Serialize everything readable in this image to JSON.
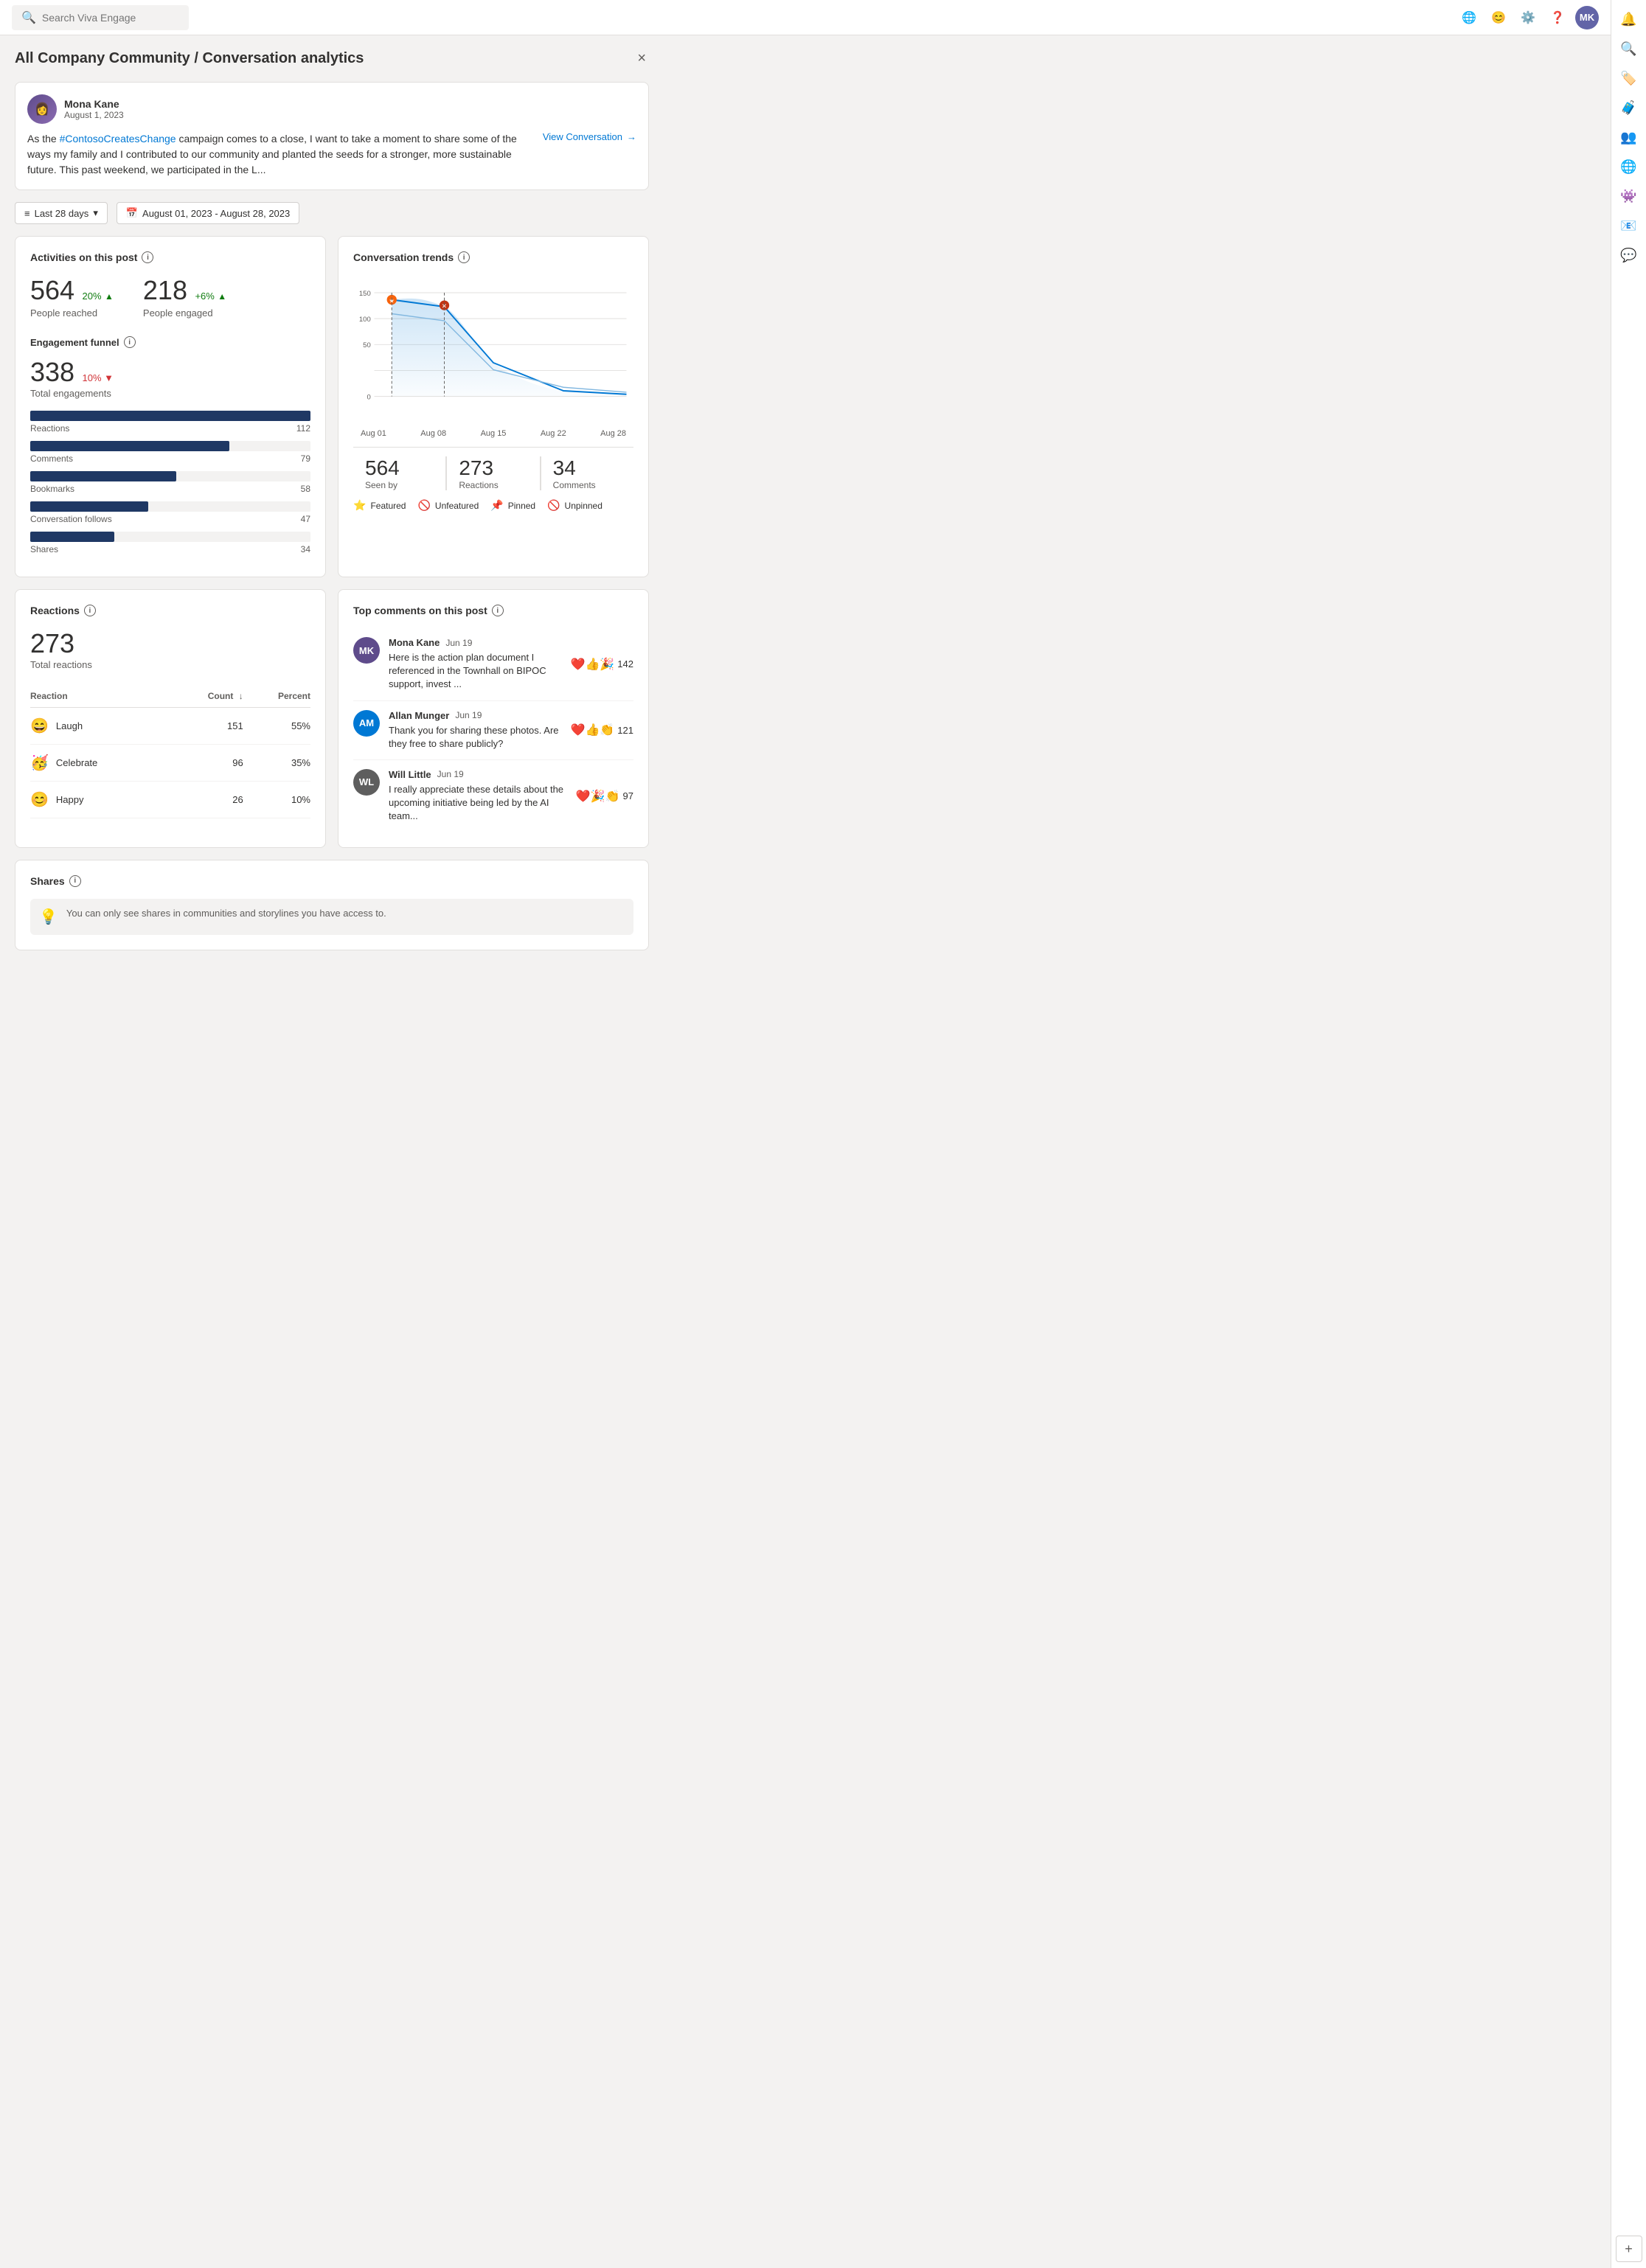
{
  "nav": {
    "search_placeholder": "Search Viva Engage",
    "icons": [
      "🌐",
      "😊",
      "⚙️",
      "❓"
    ]
  },
  "page": {
    "title": "All Company Community / Conversation analytics",
    "close_label": "×"
  },
  "post": {
    "author": "Mona Kane",
    "date": "August 1, 2023",
    "avatar_initials": "MK",
    "text_before_link": "As the ",
    "link_text": "#ContosoCreatesChange",
    "text_after": " campaign comes to a close, I want to take a moment to share some of the ways my family and I contributed to our community and planted the seeds for a stronger, more sustainable future. This past weekend, we participated in the L...",
    "view_conversation": "View Conversation"
  },
  "filter": {
    "period_label": "Last 28 days",
    "date_range": "August 01, 2023 - August 28, 2023"
  },
  "activities": {
    "title": "Activities on this post",
    "people_reached": {
      "number": "564",
      "change": "20%",
      "direction": "up",
      "label": "People reached"
    },
    "people_engaged": {
      "number": "218",
      "change": "+6%",
      "direction": "up",
      "label": "People engaged"
    },
    "engagement_funnel": {
      "title": "Engagement funnel",
      "total": "338",
      "change": "10%",
      "direction": "down",
      "label": "Total engagements",
      "bars": [
        {
          "label": "Reactions",
          "value": 112,
          "max": 112,
          "percent": 100
        },
        {
          "label": "Comments",
          "value": 79,
          "max": 112,
          "percent": 71
        },
        {
          "label": "Bookmarks",
          "value": 58,
          "max": 112,
          "percent": 52
        },
        {
          "label": "Conversation follows",
          "value": 47,
          "max": 112,
          "percent": 42
        },
        {
          "label": "Shares",
          "value": 34,
          "max": 112,
          "percent": 30
        }
      ]
    }
  },
  "trends": {
    "title": "Conversation trends",
    "stats": [
      {
        "number": "564",
        "label": "Seen by"
      },
      {
        "number": "273",
        "label": "Reactions"
      },
      {
        "number": "34",
        "label": "Comments"
      }
    ],
    "x_labels": [
      "Aug 01",
      "Aug 08",
      "Aug 15",
      "Aug 22",
      "Aug 28"
    ],
    "legend": [
      {
        "label": "Featured",
        "icon": "⭐",
        "color": "#0078d4"
      },
      {
        "label": "Unfeatured",
        "icon": "🚫",
        "color": "#5e5e5e"
      },
      {
        "label": "Pinned",
        "icon": "📌",
        "color": "#c13515"
      },
      {
        "label": "Unpinned",
        "icon": "🚫",
        "color": "#c13515"
      }
    ]
  },
  "reactions": {
    "title": "Reactions",
    "total": "273",
    "label": "Total reactions",
    "col_reaction": "Reaction",
    "col_count": "Count",
    "col_percent": "Percent",
    "items": [
      {
        "emoji": "😄",
        "name": "Laugh",
        "count": 151,
        "percent": "55%"
      },
      {
        "emoji": "🥳",
        "name": "Celebrate",
        "count": 96,
        "percent": "35%"
      },
      {
        "emoji": "😊",
        "name": "Happy",
        "count": 26,
        "percent": "10%"
      }
    ]
  },
  "top_comments": {
    "title": "Top comments on this post",
    "items": [
      {
        "author": "Mona Kane",
        "date": "Jun 19",
        "avatar_initials": "MK",
        "avatar_color": "#5e4b8b",
        "text": "Here is the action plan document I referenced in the Townhall on BIPOC support, invest ...",
        "reactions": "❤️👍🎉",
        "count": 142
      },
      {
        "author": "Allan Munger",
        "date": "Jun 19",
        "avatar_initials": "AM",
        "avatar_color": "#0078d4",
        "text": "Thank you for sharing these photos. Are they free to share publicly?",
        "reactions": "❤️👍👏",
        "count": 121
      },
      {
        "author": "Will Little",
        "date": "Jun 19",
        "avatar_initials": "WL",
        "avatar_color": "#107c10",
        "text": "I really appreciate these details about the upcoming initiative being led by the AI team...",
        "reactions": "❤️🎉👏",
        "count": 97
      }
    ]
  },
  "shares": {
    "title": "Shares",
    "info_text": "You can only see shares in communities and storylines you have access to."
  },
  "sidebar_icons": [
    "🔔",
    "🔍",
    "🏷️",
    "🧳",
    "👤",
    "🌐",
    "👾",
    "📧",
    "💬"
  ],
  "add_label": "+"
}
